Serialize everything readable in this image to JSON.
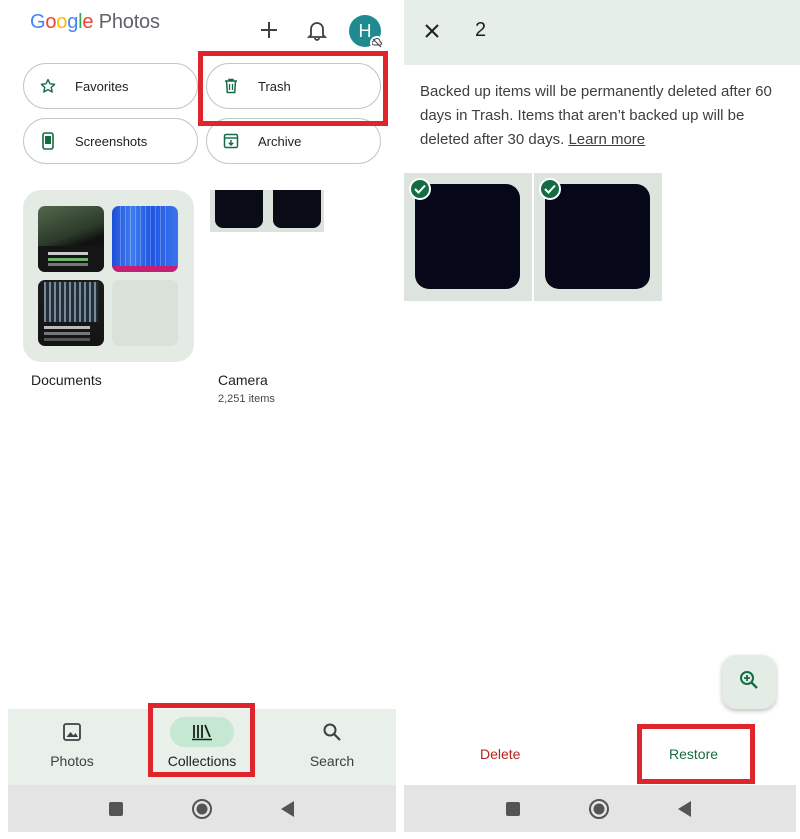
{
  "left": {
    "logo": {
      "word1": [
        "G",
        "o",
        "o",
        "g",
        "l",
        "e"
      ],
      "word2": "Photos"
    },
    "avatar_initial": "H",
    "chips": [
      {
        "label": "Favorites",
        "icon": "star-icon"
      },
      {
        "label": "Trash",
        "icon": "trash-icon"
      },
      {
        "label": "Screenshots",
        "icon": "phone-icon"
      },
      {
        "label": "Archive",
        "icon": "archive-icon"
      }
    ],
    "albums": [
      {
        "label": "Documents"
      },
      {
        "label": "Camera",
        "count": "2,251 items"
      }
    ],
    "nav": [
      {
        "label": "Photos",
        "icon": "image-icon"
      },
      {
        "label": "Collections",
        "icon": "collections-icon",
        "active": true
      },
      {
        "label": "Search",
        "icon": "search-icon"
      }
    ]
  },
  "right": {
    "selected_count": "2",
    "info_text": "Backed up items will be permanently deleted after 60 days in Trash. Items that aren’t backed up will be deleted after 30 days.",
    "learn_more": "Learn more",
    "actions": {
      "delete": "Delete",
      "restore": "Restore"
    }
  },
  "colors": {
    "accent_green": "#146c43",
    "delete_red": "#b3261e",
    "highlight_red": "#e0242b",
    "avatar": "#1f8a8f"
  }
}
